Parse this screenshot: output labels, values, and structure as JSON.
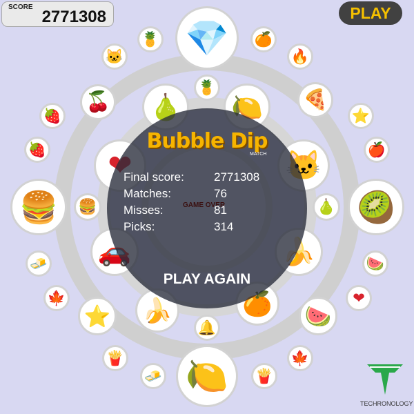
{
  "hud": {
    "score_label": "SCORE",
    "score_value": "2771308",
    "play_label": "PLAY"
  },
  "overlay": {
    "title": "Bubble Dip",
    "subtitle": "MATCH",
    "game_over": "GAME OVER",
    "stats": [
      {
        "label": "Final score:",
        "value": "2771308"
      },
      {
        "label": "Matches:",
        "value": "76"
      },
      {
        "label": "Misses:",
        "value": "81"
      },
      {
        "label": "Picks:",
        "value": "314"
      }
    ],
    "play_again": "PLAY AGAIN"
  },
  "brand": {
    "name": "TECHRONOLOGY"
  },
  "colors": {
    "background": "#d8d8f2",
    "accent": "#f5c000",
    "overlay": "#282c3a"
  },
  "bubbles": [
    {
      "name": "diamond",
      "glyph": "💎"
    },
    {
      "name": "pineapple",
      "glyph": "🍍"
    },
    {
      "name": "orange",
      "glyph": "🍊"
    },
    {
      "name": "cat",
      "glyph": "🐱"
    },
    {
      "name": "fire",
      "glyph": "🔥"
    },
    {
      "name": "cherries",
      "glyph": "🍒"
    },
    {
      "name": "pear",
      "glyph": "🍐"
    },
    {
      "name": "pineapple",
      "glyph": "🍍"
    },
    {
      "name": "lemon",
      "glyph": "🍋"
    },
    {
      "name": "pizza",
      "glyph": "🍕"
    },
    {
      "name": "strawberry",
      "glyph": "🍓"
    },
    {
      "name": "star",
      "glyph": "⭐"
    },
    {
      "name": "strawberry",
      "glyph": "🍓"
    },
    {
      "name": "heart",
      "glyph": "❤"
    },
    {
      "name": "cat",
      "glyph": "🐱"
    },
    {
      "name": "apple",
      "glyph": "🍎"
    },
    {
      "name": "burger",
      "glyph": "🍔"
    },
    {
      "name": "burger",
      "glyph": "🍔"
    },
    {
      "name": "pear",
      "glyph": "🍐"
    },
    {
      "name": "kiwi",
      "glyph": "🥝"
    },
    {
      "name": "car",
      "glyph": "🚗"
    },
    {
      "name": "banana",
      "glyph": "🍌"
    },
    {
      "name": "gold-bars",
      "glyph": "🧈"
    },
    {
      "name": "watermelon",
      "glyph": "🍉"
    },
    {
      "name": "maple-leaf",
      "glyph": "🍁"
    },
    {
      "name": "heart",
      "glyph": "❤"
    },
    {
      "name": "star",
      "glyph": "⭐"
    },
    {
      "name": "banana",
      "glyph": "🍌"
    },
    {
      "name": "orange",
      "glyph": "🍊"
    },
    {
      "name": "watermelon",
      "glyph": "🍉"
    },
    {
      "name": "bell",
      "glyph": "🔔"
    },
    {
      "name": "fries",
      "glyph": "🍟"
    },
    {
      "name": "maple-leaf",
      "glyph": "🍁"
    },
    {
      "name": "gold-bars",
      "glyph": "🧈"
    },
    {
      "name": "lemon",
      "glyph": "🍋"
    },
    {
      "name": "fries",
      "glyph": "🍟"
    }
  ]
}
